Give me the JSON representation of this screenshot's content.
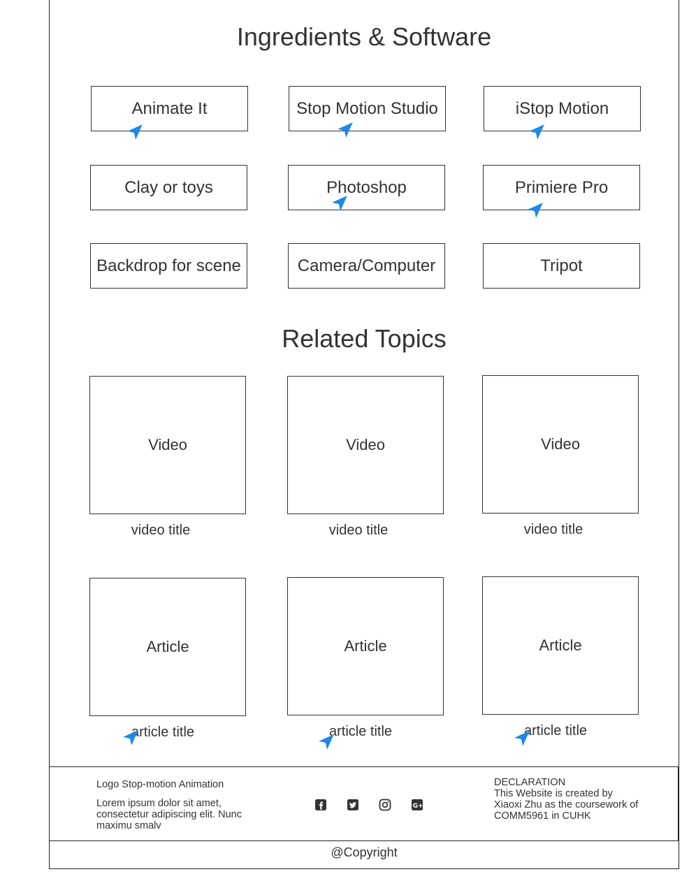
{
  "ingredients": {
    "title": "Ingredients & Software",
    "items": [
      "Animate It",
      "Stop Motion Studio",
      "iStop Motion",
      "Clay or toys",
      "Photoshop",
      "Primiere Pro",
      "Backdrop for scene",
      "Camera/Computer",
      "Tripot"
    ]
  },
  "related": {
    "title": "Related Topics",
    "videos": [
      {
        "label": "Video",
        "title": "video title"
      },
      {
        "label": "Video",
        "title": "video title"
      },
      {
        "label": "Video",
        "title": "video title"
      }
    ],
    "articles": [
      {
        "label": "Article",
        "title": "article title"
      },
      {
        "label": "Article",
        "title": "article title"
      },
      {
        "label": "Article",
        "title": "article title"
      }
    ]
  },
  "footer": {
    "logo": "Logo Stop-motion Animation",
    "lorem": "Lorem ipsum dolor sit amet, consectetur adipiscing elit. Nunc maximu smalv",
    "declaration": "DECLARATION\nThis Website is created by Xiaoxi Zhu as the coursework of COMM5961 in CUHK",
    "icons": [
      "facebook-icon",
      "twitter-icon",
      "instagram-icon",
      "google-plus-icon"
    ]
  },
  "copyright": "@Copyright",
  "colors": {
    "cursor": "#1e88e5",
    "border": "#333333"
  }
}
